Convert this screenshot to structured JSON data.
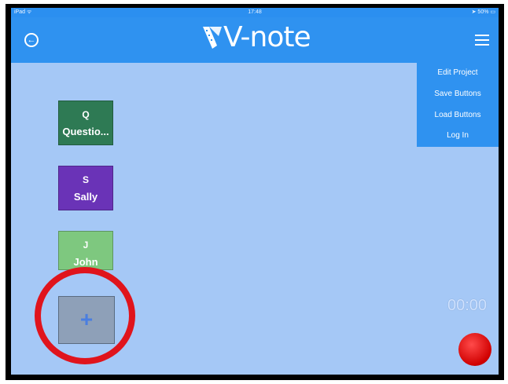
{
  "status_bar": {
    "device": "iPad",
    "wifi_icon": "wifi-icon",
    "time": "17:48",
    "battery": "50%"
  },
  "nav": {
    "back_icon": "back-arrow-circle-icon",
    "logo": "V-note",
    "menu_icon": "hamburger-menu-icon",
    "accent_color": "#2f92f0"
  },
  "menu": {
    "items": [
      {
        "label": "Edit Project"
      },
      {
        "label": "Save Buttons"
      },
      {
        "label": "Load Buttons"
      },
      {
        "label": "Log In"
      }
    ]
  },
  "buttons": [
    {
      "letter": "Q",
      "name": "Questio...",
      "color": "#2e7a54"
    },
    {
      "letter": "S",
      "name": "Sally",
      "color": "#6a33b7"
    },
    {
      "letter": "J",
      "name": "John",
      "color": "#7ec87f"
    }
  ],
  "add_button": {
    "label": "+"
  },
  "timer": "00:00",
  "record_color": "#e00000",
  "highlight_color": "#e0141c"
}
